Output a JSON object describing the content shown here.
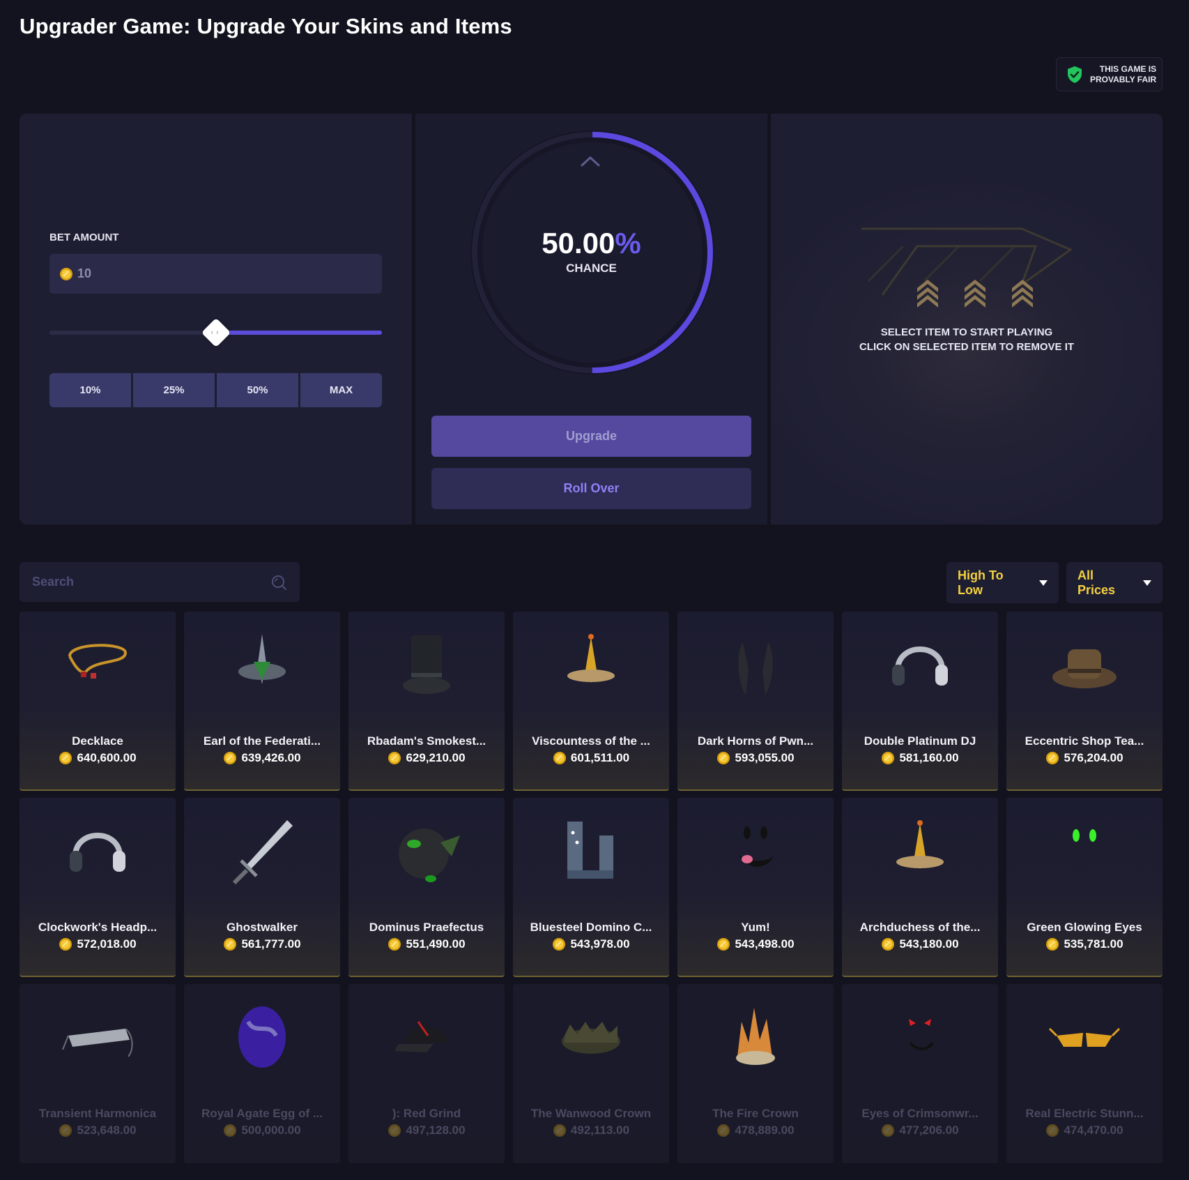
{
  "page": {
    "title": "Upgrader Game: Upgrade Your Skins and Items"
  },
  "fair_badge": {
    "line1": "THIS GAME IS",
    "line2": "PROVABLY FAIR",
    "icon": "shield-check-icon"
  },
  "bet": {
    "label": "BET AMOUNT",
    "value": "10",
    "slider_fraction": 0.5,
    "buttons": [
      "10%",
      "25%",
      "50%",
      "MAX"
    ]
  },
  "upgrade": {
    "chance_number": "50.00",
    "chance_symbol": "%",
    "chance_label": "CHANCE",
    "chance_fraction": 0.5,
    "upgrade_label": "Upgrade",
    "rollover_label": "Roll Over"
  },
  "target": {
    "hint_line1": "SELECT ITEM TO START PLAYING",
    "hint_line2": "CLICK ON SELECTED ITEM TO REMOVE IT"
  },
  "filters": {
    "search_placeholder": "Search",
    "sort_label": "High To Low",
    "price_label": "All Prices"
  },
  "colors": {
    "accent": "#5c4ddb",
    "gold": "#f4d03f",
    "panel": "#1e1e33",
    "background": "#13131f"
  },
  "items": [
    {
      "name": "Decklace",
      "price": "640,600.00",
      "icon": "necklace-icon"
    },
    {
      "name": "Earl of the Federati...",
      "price": "639,426.00",
      "icon": "crown-icon"
    },
    {
      "name": "Rbadam's Smokest...",
      "price": "629,210.00",
      "icon": "top-hat-icon"
    },
    {
      "name": "Viscountess of the ...",
      "price": "601,511.00",
      "icon": "tiara-icon"
    },
    {
      "name": "Dark Horns of Pwn...",
      "price": "593,055.00",
      "icon": "horns-icon"
    },
    {
      "name": "Double Platinum DJ",
      "price": "581,160.00",
      "icon": "headphones-icon"
    },
    {
      "name": "Eccentric Shop Tea...",
      "price": "576,204.00",
      "icon": "bowler-hat-icon"
    },
    {
      "name": "Clockwork's Headp...",
      "price": "572,018.00",
      "icon": "headphones-icon"
    },
    {
      "name": "Ghostwalker",
      "price": "561,777.00",
      "icon": "sword-icon"
    },
    {
      "name": "Dominus Praefectus",
      "price": "551,490.00",
      "icon": "helmet-icon"
    },
    {
      "name": "Bluesteel Domino C...",
      "price": "543,978.00",
      "icon": "domino-crown-icon"
    },
    {
      "name": "Yum!",
      "price": "543,498.00",
      "icon": "face-icon"
    },
    {
      "name": "Archduchess of the...",
      "price": "543,180.00",
      "icon": "tiara-icon"
    },
    {
      "name": "Green Glowing Eyes",
      "price": "535,781.00",
      "icon": "glowing-eyes-icon"
    },
    {
      "name": "Transient Harmonica",
      "price": "523,648.00",
      "icon": "harmonica-icon"
    },
    {
      "name": "Royal Agate Egg of ...",
      "price": "500,000.00",
      "icon": "egg-icon"
    },
    {
      "name": "): Red Grind",
      "price": "497,128.00",
      "icon": "cap-icon"
    },
    {
      "name": "The Wanwood Crown",
      "price": "492,113.00",
      "icon": "wood-crown-icon"
    },
    {
      "name": "The Fire Crown",
      "price": "478,889.00",
      "icon": "fire-crown-icon"
    },
    {
      "name": "Eyes of Crimsonwr...",
      "price": "477,206.00",
      "icon": "red-eyes-icon"
    },
    {
      "name": "Real Electric Stunn...",
      "price": "474,470.00",
      "icon": "shades-icon"
    }
  ]
}
